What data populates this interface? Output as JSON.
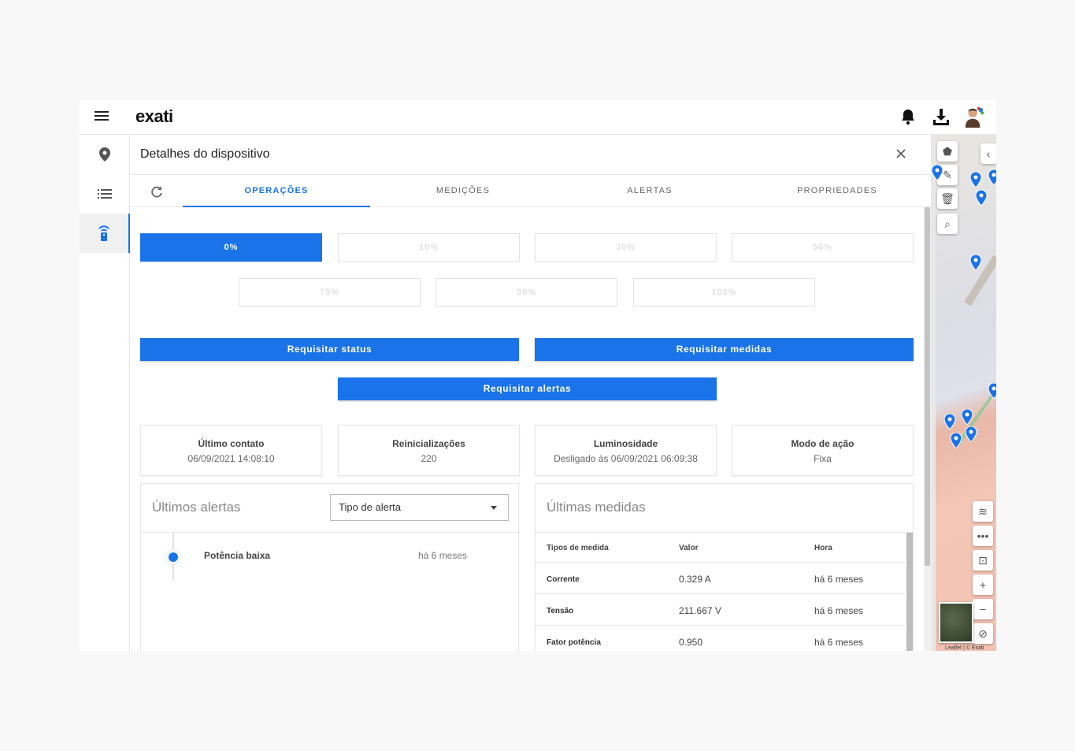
{
  "app": {
    "logo": "exati"
  },
  "panel": {
    "title": "Detalhes do dispositivo"
  },
  "tabs": [
    {
      "label": "OPERAÇÕES"
    },
    {
      "label": "MEDIÇÕES"
    },
    {
      "label": "ALERTAS"
    },
    {
      "label": "PROPRIEDADES"
    }
  ],
  "dimming": [
    "0%",
    "10%",
    "30%",
    "50%",
    "75%",
    "90%",
    "100%"
  ],
  "actions": {
    "status": "Requisitar status",
    "measures": "Requisitar medidas",
    "alerts": "Requisitar alertas"
  },
  "cards": [
    {
      "title": "Último contato",
      "value": "06/09/2021 14:08:10"
    },
    {
      "title": "Reinicializações",
      "value": "220"
    },
    {
      "title": "Luminosidade",
      "value": "Desligado às 06/09/2021 06:09:38"
    },
    {
      "title": "Modo de ação",
      "value": "Fixa"
    }
  ],
  "alerts_box": {
    "title": "Últimos alertas",
    "select_value": "Tipo de alerta",
    "items": [
      {
        "name": "Potência baixa",
        "time": "há 6 meses"
      }
    ]
  },
  "measures_box": {
    "title": "Últimas medidas",
    "headers": [
      "Tipos de medida",
      "Valor",
      "Hora"
    ],
    "rows": [
      [
        "Corrente",
        "0.329 A",
        "há 6 meses"
      ],
      [
        "Tensão",
        "211.667 V",
        "há 6 meses"
      ],
      [
        "Fator potência",
        "0.950",
        "há 6 meses"
      ]
    ]
  },
  "map": {
    "attribution": "Leaflet | © Exati"
  },
  "colors": {
    "accent": "#1a73e8"
  }
}
